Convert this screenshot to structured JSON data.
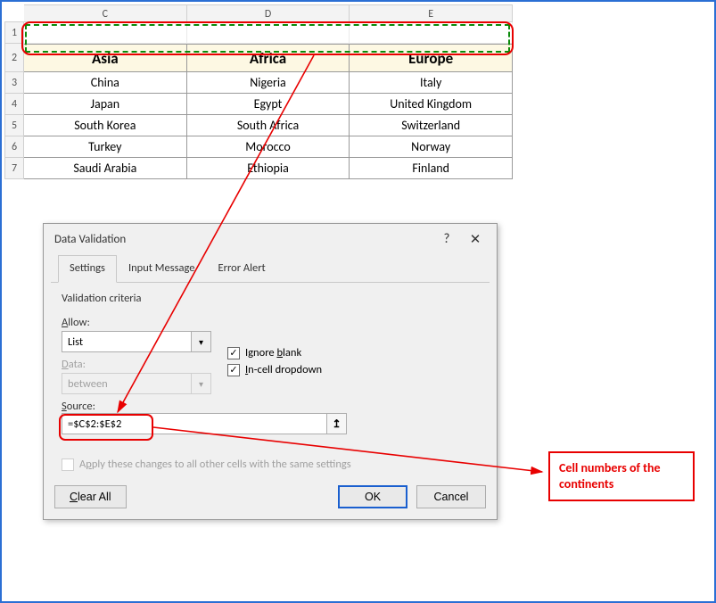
{
  "sheet": {
    "columns": [
      "C",
      "D",
      "E"
    ],
    "row_numbers": [
      "1",
      "2",
      "3",
      "4",
      "5",
      "6",
      "7"
    ],
    "headers": [
      "Asia",
      "Africa",
      "Europe"
    ],
    "rows": [
      [
        "China",
        "Nigeria",
        "Italy"
      ],
      [
        "Japan",
        "Egypt",
        "United Kingdom"
      ],
      [
        "South Korea",
        "South Africa",
        "Switzerland"
      ],
      [
        "Turkey",
        "Morocco",
        "Norway"
      ],
      [
        "Saudi Arabia",
        "Ethiopia",
        "Finland"
      ]
    ]
  },
  "dialog": {
    "title": "Data Validation",
    "tabs": [
      "Settings",
      "Input Message",
      "Error Alert"
    ],
    "group": "Validation criteria",
    "allow_label": "Allow:",
    "allow_value": "List",
    "data_label": "Data:",
    "data_value": "between",
    "ignore_blank": "Ignore blank",
    "incell_dropdown": "In-cell dropdown",
    "source_label": "Source:",
    "source_value": "=$C$2:$E$2",
    "apply_all": "Apply these changes to all other cells with the same settings",
    "clear_all": "Clear All",
    "ok": "OK",
    "cancel": "Cancel"
  },
  "annotation": {
    "text": "Cell numbers of the continents"
  }
}
